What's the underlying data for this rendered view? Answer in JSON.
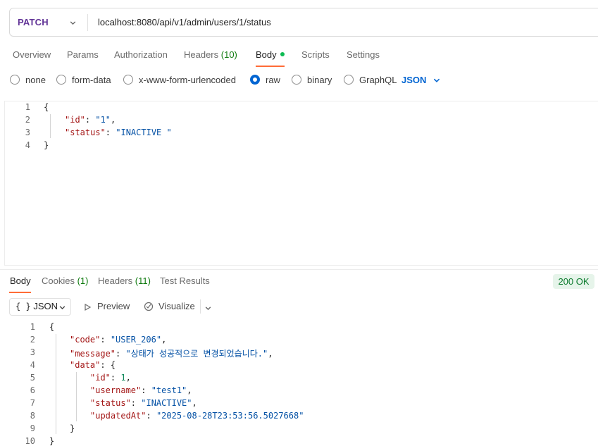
{
  "request": {
    "method": "PATCH",
    "url": "localhost:8080/api/v1/admin/users/1/status"
  },
  "tabs": {
    "overview": "Overview",
    "params": "Params",
    "authorization": "Authorization",
    "headers": "Headers",
    "headers_count": "(10)",
    "body": "Body",
    "scripts": "Scripts",
    "settings": "Settings"
  },
  "body_types": {
    "none": "none",
    "form_data": "form-data",
    "urlencoded": "x-www-form-urlencoded",
    "raw": "raw",
    "binary": "binary",
    "graphql": "GraphQL",
    "selected_format": "JSON"
  },
  "request_body": {
    "line_numbers": [
      "1",
      "2",
      "3",
      "4"
    ],
    "lines": {
      "l1": "{",
      "l2_key": "\"id\"",
      "l2_val": "\"1\"",
      "l3_key": "\"status\"",
      "l3_val": "\"INACTIVE \"",
      "l4": "}"
    }
  },
  "response": {
    "tabs": {
      "body": "Body",
      "cookies": "Cookies",
      "cookies_count": "(1)",
      "headers": "Headers",
      "headers_count": "(11)",
      "test_results": "Test Results"
    },
    "status": "200 OK",
    "format_label": "JSON",
    "format_brace": "{ }",
    "preview": "Preview",
    "visualize": "Visualize",
    "line_numbers": [
      "1",
      "2",
      "3",
      "4",
      "5",
      "6",
      "7",
      "8",
      "9",
      "10"
    ],
    "lines": {
      "open": "{",
      "code_key": "\"code\"",
      "code_val": "\"USER_206\"",
      "message_key": "\"message\"",
      "message_val": "\"상태가 성공적으로 변경되었습니다.\"",
      "data_key": "\"data\"",
      "id_key": "\"id\"",
      "id_val": "1",
      "username_key": "\"username\"",
      "username_val": "\"test1\"",
      "status_key": "\"status\"",
      "status_val": "\"INACTIVE\"",
      "updated_key": "\"updatedAt\"",
      "updated_val": "\"2025-08-28T23:53:56.5027668\"",
      "inner_close": "}",
      "close": "}"
    }
  },
  "colors": {
    "method": "#623497",
    "accent": "#ff6c37",
    "link_blue": "#0265d2",
    "status_green": "#0a7a2c",
    "json_key": "#a31515",
    "json_string": "#0451a5"
  },
  "icons": [
    "chevron-down-icon",
    "play-icon",
    "visualize-icon"
  ]
}
